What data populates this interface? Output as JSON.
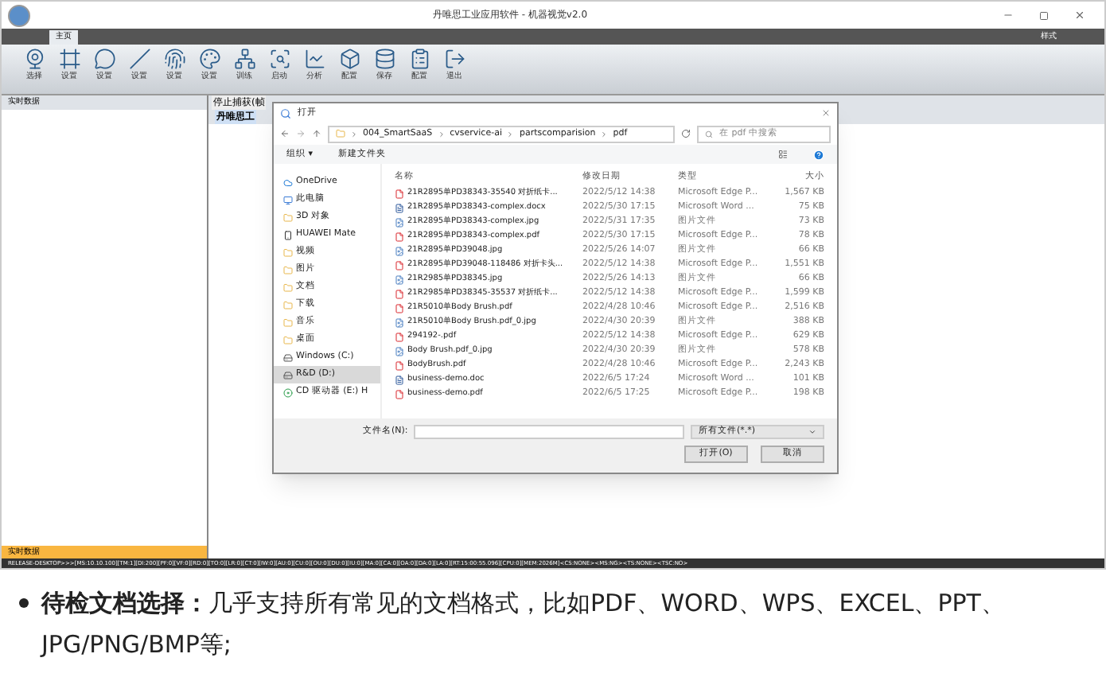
{
  "window": {
    "title": "丹唯思工业应用软件 - 机器视觉v2.0"
  },
  "ribbon_tabs": [
    {
      "label": "主页",
      "selected": true
    }
  ],
  "style_menu": "样式",
  "tools": [
    {
      "label": "选择"
    },
    {
      "label": "设置"
    },
    {
      "label": "设置"
    },
    {
      "label": "设置"
    },
    {
      "label": "设置"
    },
    {
      "label": "设置"
    },
    {
      "label": "训练"
    },
    {
      "label": "启动"
    },
    {
      "label": "分析"
    },
    {
      "label": "配置"
    },
    {
      "label": "保存"
    },
    {
      "label": "配置"
    },
    {
      "label": "退出"
    }
  ],
  "left_panel": {
    "title": "实时数据",
    "footer": "实时数据"
  },
  "doc_tabs": [
    {
      "label": "停止捕获(帧",
      "selected": false
    },
    {
      "label": "丹唯思工",
      "selected": true
    }
  ],
  "dialog": {
    "title": "打开",
    "path": [
      "004_SmartSaaS",
      "cvservice-ai",
      "partscomparision",
      "pdf"
    ],
    "search_placeholder": "在 pdf 中搜索",
    "organize": "组织 ▾",
    "new_folder": "新建文件夹",
    "nav": [
      {
        "label": "OneDrive",
        "kind": "cloud",
        "selected": false
      },
      {
        "label": "此电脑",
        "kind": "pc",
        "selected": false
      },
      {
        "label": "3D 对象",
        "kind": "folder",
        "selected": false
      },
      {
        "label": "HUAWEI Mate",
        "kind": "phone",
        "selected": false
      },
      {
        "label": "视频",
        "kind": "folder",
        "selected": false
      },
      {
        "label": "图片",
        "kind": "folder",
        "selected": false
      },
      {
        "label": "文档",
        "kind": "folder",
        "selected": false
      },
      {
        "label": "下载",
        "kind": "folder",
        "selected": false
      },
      {
        "label": "音乐",
        "kind": "folder",
        "selected": false
      },
      {
        "label": "桌面",
        "kind": "folder",
        "selected": false
      },
      {
        "label": "Windows (C:)",
        "kind": "drive",
        "selected": false
      },
      {
        "label": "R&D (D:)",
        "kind": "drive",
        "selected": true
      },
      {
        "label": "CD 驱动器 (E:) H",
        "kind": "cd",
        "selected": false
      }
    ],
    "columns": [
      "名称",
      "修改日期",
      "类型",
      "大小"
    ],
    "files": [
      {
        "name": "21R2895单PD38343-35540 对折纸卡...",
        "date": "2022/5/12 14:38",
        "type": "Microsoft Edge P...",
        "size": "1,567 KB",
        "kind": "pdf"
      },
      {
        "name": "21R2895单PD38343-complex.docx",
        "date": "2022/5/30 17:15",
        "type": "Microsoft Word ...",
        "size": "75 KB",
        "kind": "doc"
      },
      {
        "name": "21R2895单PD38343-complex.jpg",
        "date": "2022/5/31 17:35",
        "type": "图片文件",
        "size": "73 KB",
        "kind": "img"
      },
      {
        "name": "21R2895单PD38343-complex.pdf",
        "date": "2022/5/30 17:15",
        "type": "Microsoft Edge P...",
        "size": "78 KB",
        "kind": "pdf"
      },
      {
        "name": "21R2895单PD39048.jpg",
        "date": "2022/5/26 14:07",
        "type": "图片文件",
        "size": "66 KB",
        "kind": "img"
      },
      {
        "name": "21R2895单PD39048-118486 对折卡头...",
        "date": "2022/5/12 14:38",
        "type": "Microsoft Edge P...",
        "size": "1,551 KB",
        "kind": "pdf"
      },
      {
        "name": "21R2985单PD38345.jpg",
        "date": "2022/5/26 14:13",
        "type": "图片文件",
        "size": "66 KB",
        "kind": "img"
      },
      {
        "name": "21R2985单PD38345-35537 对折纸卡...",
        "date": "2022/5/12 14:38",
        "type": "Microsoft Edge P...",
        "size": "1,599 KB",
        "kind": "pdf"
      },
      {
        "name": "21R5010单Body Brush.pdf",
        "date": "2022/4/28 10:46",
        "type": "Microsoft Edge P...",
        "size": "2,516 KB",
        "kind": "pdf"
      },
      {
        "name": "21R5010单Body Brush.pdf_0.jpg",
        "date": "2022/4/30 20:39",
        "type": "图片文件",
        "size": "388 KB",
        "kind": "img"
      },
      {
        "name": "294192-.pdf",
        "date": "2022/5/12 14:38",
        "type": "Microsoft Edge P...",
        "size": "629 KB",
        "kind": "pdf"
      },
      {
        "name": "Body Brush.pdf_0.jpg",
        "date": "2022/4/30 20:39",
        "type": "图片文件",
        "size": "578 KB",
        "kind": "img"
      },
      {
        "name": "BodyBrush.pdf",
        "date": "2022/4/28 10:46",
        "type": "Microsoft Edge P...",
        "size": "2,243 KB",
        "kind": "pdf"
      },
      {
        "name": "business-demo.doc",
        "date": "2022/6/5 17:24",
        "type": "Microsoft Word ...",
        "size": "101 KB",
        "kind": "doc"
      },
      {
        "name": "business-demo.pdf",
        "date": "2022/6/5 17:25",
        "type": "Microsoft Edge P...",
        "size": "198 KB",
        "kind": "pdf"
      }
    ],
    "filename_label": "文件名(N):",
    "filter": "所有文件(*.*)",
    "open_button": "打开(O)",
    "cancel_button": "取消"
  },
  "status_bar": "RELEASE-DESKTOP>>>[MS:10.10.100][TM:1][DI:200][PF:0][VF:0][RD:0][TO:0][LR:0][CT:0][IW:0][AU:0][CU:0][OU:0][DU:0][IU:0][MA:0][CA:0][OA:0][DA:0][LA:0][RT:15:00:55.096][CPU:0][MEM:2026M]<CS:NONE><MS:NG><TS:NONE><TSC:NO>",
  "bullet": {
    "lead": "待检文档选择：",
    "text": "几乎支持所有常见的文档格式，比如PDF、WORD、WPS、EXCEL、PPT、JPG/PNG/BMP等;"
  }
}
